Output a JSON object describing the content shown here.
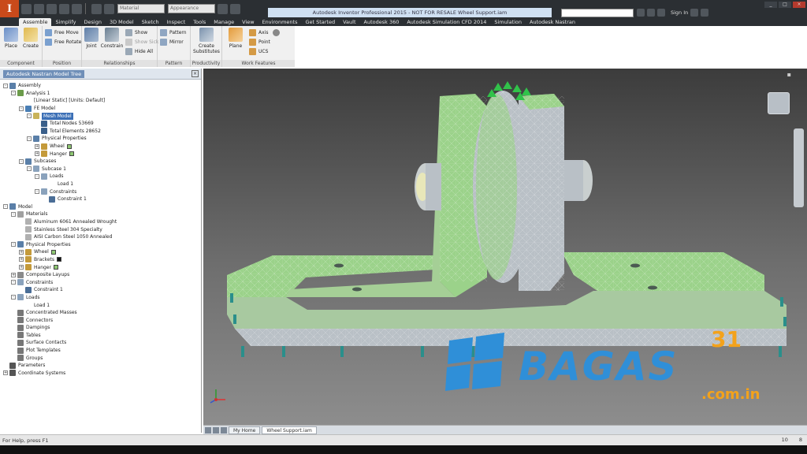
{
  "app": {
    "logo_letter": "I",
    "title": "Autodesk Inventor Professional 2015 - NOT FOR RESALE   Wheel Support.iam",
    "combo_material": "Material",
    "combo_appearance": "Appearance",
    "search_placeholder": "",
    "signin": "Sign In"
  },
  "ribbon_tabs": [
    "Assemble",
    "Simplify",
    "Design",
    "3D Model",
    "Sketch",
    "Inspect",
    "Tools",
    "Manage",
    "View",
    "Environments",
    "Get Started",
    "Vault",
    "Autodesk 360",
    "Autodesk Simulation CFD 2014",
    "Simulation",
    "Autodesk Nastran"
  ],
  "ribbon": {
    "component": {
      "label": "Component",
      "place": "Place",
      "create": "Create"
    },
    "position": {
      "label": "Position",
      "free_move": "Free Move",
      "free_rotate": "Free Rotate"
    },
    "relationships": {
      "label": "Relationships",
      "joint": "Joint",
      "constrain": "Constrain",
      "show": "Show",
      "show_sick": "Show Sick",
      "hide_all": "Hide All"
    },
    "pattern": {
      "label": "Pattern",
      "pattern": "Pattern",
      "mirror": "Mirror"
    },
    "productivity": {
      "label": "Productivity",
      "create_substitutes": "Create Substitutes"
    },
    "work_features": {
      "label": "Work Features",
      "plane": "Plane",
      "axis": "Axis",
      "point": "Point",
      "ucs": "UCS"
    }
  },
  "browser": {
    "title": "Autodesk Nastran Model Tree",
    "nodes": [
      {
        "depth": 0,
        "exp": "-",
        "label": "Assembly",
        "icon": "#5a7fa8"
      },
      {
        "depth": 1,
        "exp": "-",
        "label": "Analysis 1",
        "icon": "#6b9b4a"
      },
      {
        "depth": 2,
        "exp": "",
        "label": "[Linear Static] [Units: Default]",
        "icon": ""
      },
      {
        "depth": 2,
        "exp": "-",
        "label": "FE Model",
        "icon": "#4a7fb5"
      },
      {
        "depth": 3,
        "exp": "-",
        "label": "Mesh Model",
        "icon": "#c9b35a",
        "selected": true
      },
      {
        "depth": 4,
        "exp": "",
        "label": "Total Nodes 53669",
        "icon": "#3a5f8a"
      },
      {
        "depth": 4,
        "exp": "",
        "label": "Total Elements 28652",
        "icon": "#3a5f8a"
      },
      {
        "depth": 3,
        "exp": "-",
        "label": "Physical Properties",
        "icon": "#5a7fa8"
      },
      {
        "depth": 4,
        "exp": "+",
        "label": "Wheel",
        "icon": "#c49a3a",
        "swatch": "#8fc873"
      },
      {
        "depth": 4,
        "exp": "+",
        "label": "Hanger",
        "icon": "#c49a3a",
        "swatch": "#8fc873"
      },
      {
        "depth": 2,
        "exp": "-",
        "label": "Subcases",
        "icon": "#5a7fa8"
      },
      {
        "depth": 3,
        "exp": "-",
        "label": "Subcase 1",
        "icon": "#8aa2bc"
      },
      {
        "depth": 4,
        "exp": "-",
        "label": "Loads",
        "icon": "#8aa2bc"
      },
      {
        "depth": 5,
        "exp": "",
        "label": "Load 1",
        "icon": ""
      },
      {
        "depth": 4,
        "exp": "-",
        "label": "Constraints",
        "icon": "#8aa2bc"
      },
      {
        "depth": 5,
        "exp": "",
        "label": "Constraint 1",
        "icon": "#4a6d96"
      },
      {
        "depth": 0,
        "exp": "-",
        "label": "Model",
        "icon": "#5a7fa8"
      },
      {
        "depth": 1,
        "exp": "-",
        "label": "Materials",
        "icon": "#a0a0a0"
      },
      {
        "depth": 2,
        "exp": "",
        "label": "Aluminum 6061 Annealed Wrought",
        "icon": "#b0b0b0"
      },
      {
        "depth": 2,
        "exp": "",
        "label": "Stainless Steel 304 Specialty",
        "icon": "#b0b0b0"
      },
      {
        "depth": 2,
        "exp": "",
        "label": "AISI Carbon Steel 1050 Annealed",
        "icon": "#b0b0b0"
      },
      {
        "depth": 1,
        "exp": "-",
        "label": "Physical Properties",
        "icon": "#5a7fa8"
      },
      {
        "depth": 2,
        "exp": "+",
        "label": "Wheel",
        "icon": "#c49a3a",
        "swatch": "#8fc873"
      },
      {
        "depth": 2,
        "exp": "+",
        "label": "Brackets",
        "icon": "#c49a3a",
        "swatch": "#111111"
      },
      {
        "depth": 2,
        "exp": "+",
        "label": "Hanger",
        "icon": "#c49a3a",
        "swatch": "#8fc873"
      },
      {
        "depth": 1,
        "exp": "+",
        "label": "Composite Layups",
        "icon": "#8a8a8a"
      },
      {
        "depth": 1,
        "exp": "-",
        "label": "Constraints",
        "icon": "#8aa2bc"
      },
      {
        "depth": 2,
        "exp": "",
        "label": "Constraint 1",
        "icon": "#4a6d96"
      },
      {
        "depth": 1,
        "exp": "-",
        "label": "Loads",
        "icon": "#8aa2bc"
      },
      {
        "depth": 2,
        "exp": "",
        "label": "Load 1",
        "icon": ""
      },
      {
        "depth": 1,
        "exp": "",
        "label": "Concentrated Masses",
        "icon": "#777"
      },
      {
        "depth": 1,
        "exp": "",
        "label": "Connectors",
        "icon": "#777"
      },
      {
        "depth": 1,
        "exp": "",
        "label": "Dampings",
        "icon": "#777"
      },
      {
        "depth": 1,
        "exp": "",
        "label": "Tables",
        "icon": "#777"
      },
      {
        "depth": 1,
        "exp": "",
        "label": "Surface Contacts",
        "icon": "#777"
      },
      {
        "depth": 1,
        "exp": "",
        "label": "Plot Templates",
        "icon": "#777"
      },
      {
        "depth": 1,
        "exp": "",
        "label": "Groups",
        "icon": "#777"
      },
      {
        "depth": 0,
        "exp": "",
        "label": "Parameters",
        "icon": "#555"
      },
      {
        "depth": 0,
        "exp": "+",
        "label": "Coordinate Systems",
        "icon": "#555"
      }
    ]
  },
  "doc_tabs": [
    "My Home",
    "Wheel Support.iam"
  ],
  "status": {
    "left": "For Help, press F1",
    "right_a": "10",
    "right_b": "8"
  },
  "watermark": {
    "word": "BAGAS",
    "number": "31",
    "domain": ".com.in"
  },
  "colors": {
    "mesh_green": "#9bd28a",
    "mesh_steel": "#b9c0c6",
    "constraint_teal": "#2a8f8b",
    "load_green": "#31c24a",
    "watermark_blue": "#2f8fd8",
    "watermark_orange": "#f3a21b"
  }
}
